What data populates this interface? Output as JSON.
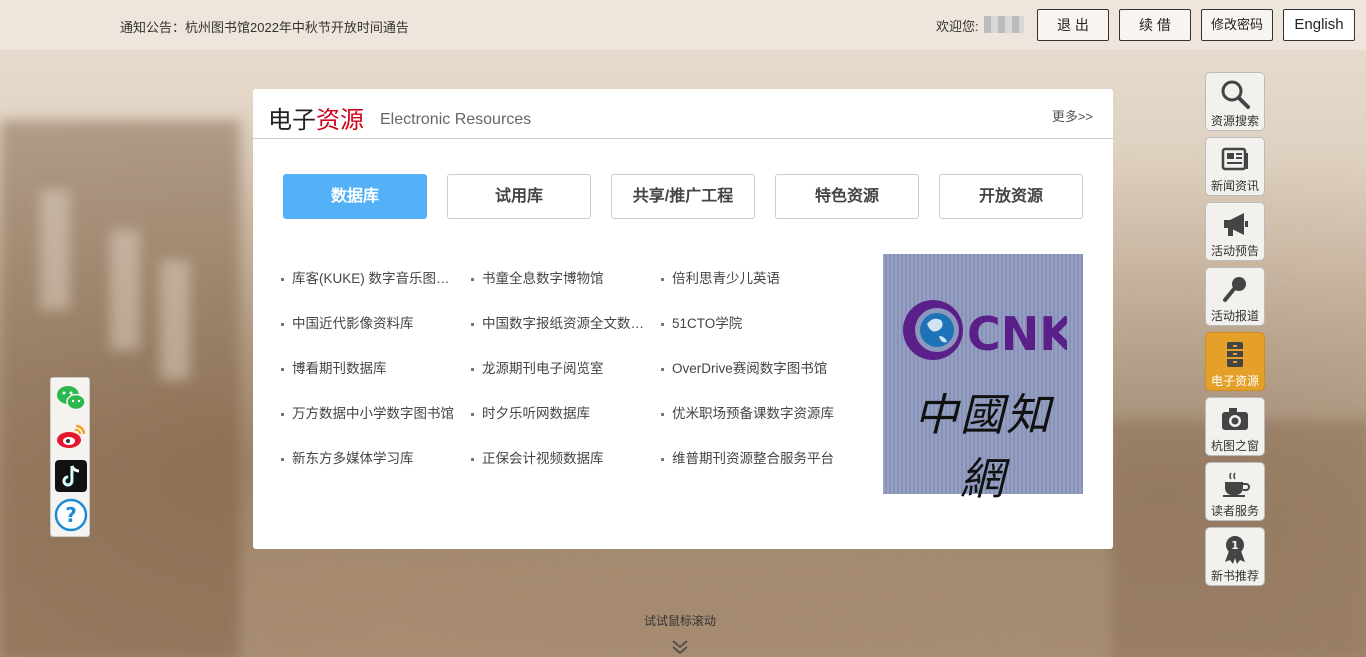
{
  "topbar": {
    "notice": "通知公告：杭州图书馆2022年中秋节开放时间通告",
    "welcome": "欢迎您:",
    "logout": "退 出",
    "renew": "续 借",
    "change_password": "修改密码",
    "english": "English"
  },
  "panel": {
    "title_prefix": "电子",
    "title_red": "资源",
    "title_en": "Electronic Resources",
    "more": "更多>>",
    "tabs": [
      "数据库",
      "试用库",
      "共享/推广工程",
      "特色资源",
      "开放资源"
    ],
    "links": [
      "库客(KUKE) 数字音乐图书馆",
      "书童全息数字博物馆",
      "倍利思青少儿英语",
      "中国近代影像资料库",
      "中国数字报纸资源全文数据库",
      "51CTO学院",
      "博看期刊数据库",
      "龙源期刊电子阅览室",
      "OverDrive赛阅数字图书馆",
      "万方数据中小学数字图书馆",
      "时夕乐听网数据库",
      "优米职场预备课数字资源库",
      "新东方多媒体学习库",
      "正保会计视频数据库",
      "维普期刊资源整合服务平台"
    ],
    "cnki_logo": "CNKI",
    "cnki_cn": "中國知網"
  },
  "sidebar": [
    {
      "label": "资源搜索",
      "icon": "search-icon"
    },
    {
      "label": "新闻资讯",
      "icon": "newspaper-icon"
    },
    {
      "label": "活动预告",
      "icon": "megaphone-icon"
    },
    {
      "label": "活动报道",
      "icon": "microphone-icon"
    },
    {
      "label": "电子资源",
      "icon": "cabinet-icon",
      "active": true
    },
    {
      "label": "杭图之窗",
      "icon": "camera-icon"
    },
    {
      "label": "读者服务",
      "icon": "coffee-icon"
    },
    {
      "label": "新书推荐",
      "icon": "award-icon"
    }
  ],
  "social": [
    "wechat-icon",
    "weibo-icon",
    "tiktok-icon",
    "help-icon"
  ],
  "scroll_hint": "试试鼠标滚动",
  "colors": {
    "tab_active": "#55b1f7",
    "sidebar_active": "#e5a02a",
    "title_red": "#d0021b"
  }
}
